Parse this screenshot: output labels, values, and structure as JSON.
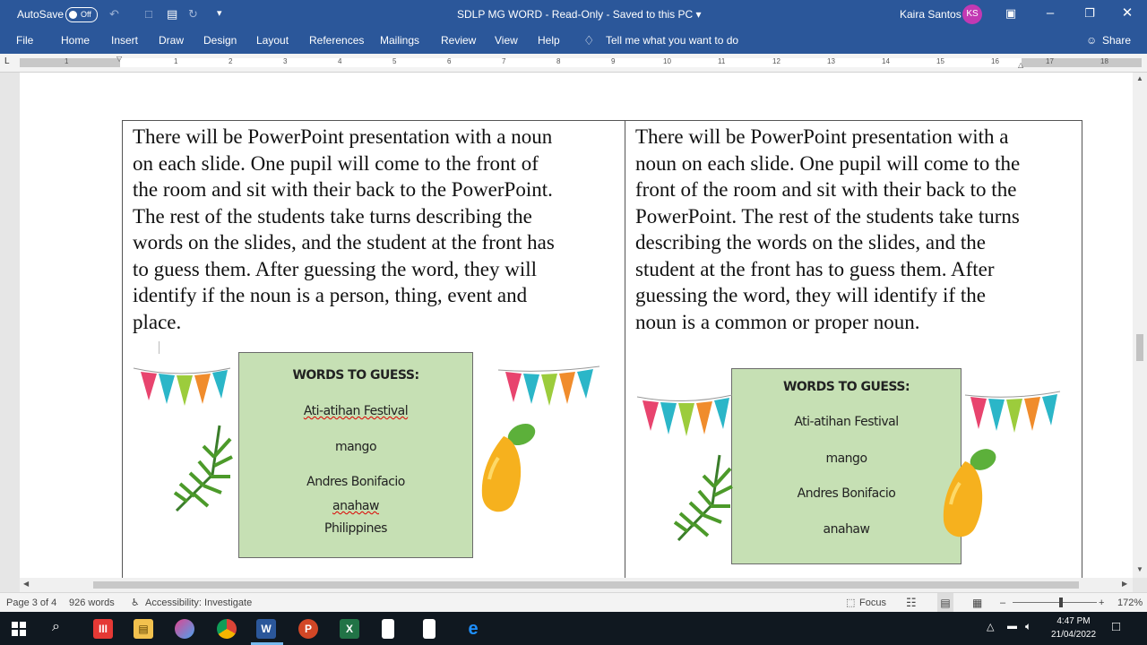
{
  "titlebar": {
    "autosave_label": "AutoSave",
    "autosave_state": "Off",
    "doc_title": "SDLP MG WORD  -  Read-Only  -  Saved to this PC  ▾",
    "user_name": "Kaira Santos",
    "user_initials": "KS"
  },
  "menu": {
    "file": "File",
    "home": "Home",
    "insert": "Insert",
    "draw": "Draw",
    "design": "Design",
    "layout": "Layout",
    "references": "References",
    "mailings": "Mailings",
    "review": "Review",
    "view": "View",
    "help": "Help",
    "tell_me": "Tell me what you want to do",
    "share": "Share"
  },
  "ruler": {
    "numbers": [
      "1",
      "1",
      "2",
      "3",
      "4",
      "5",
      "6",
      "7",
      "8",
      "9",
      "10",
      "11",
      "12",
      "13",
      "14",
      "15",
      "16",
      "17",
      "18"
    ]
  },
  "document": {
    "left_paragraph": [
      "There will be PowerPoint presentation with a noun",
      "on each slide. One pupil will come to the front of",
      "the room and sit with their back to the PowerPoint.",
      "The rest of the students take turns describing the",
      "words on the slides, and the student at the front has",
      "to guess them. After guessing the word, they will",
      "identify if the noun is a person, thing, event and",
      "place."
    ],
    "right_paragraph": [
      "There will be PowerPoint presentation with a",
      "noun on each slide. One pupil will come to the",
      "front of the room and sit with their back to the",
      "PowerPoint. The rest of the students take turns",
      "describing the words on the slides, and the",
      "student at the front has to guess them. After",
      "guessing the word, they will identify if the",
      "noun is a common or proper noun."
    ],
    "left_card": {
      "heading": "WORDS TO GUESS:",
      "word1": "Ati-atihan Festival",
      "word2": "mango",
      "word3": "Andres Bonifacio",
      "word4": "anahaw",
      "word5": "Philippines"
    },
    "right_card": {
      "heading": "WORDS TO GUESS:",
      "word1": "Ati-atihan Festival",
      "word2": "mango",
      "word3": "Andres Bonifacio",
      "word4": "anahaw"
    }
  },
  "status": {
    "page": "Page 3 of 4",
    "words": "926 words",
    "accessibility": "Accessibility: Investigate",
    "focus": "Focus",
    "zoom": "172%"
  },
  "taskbar": {
    "time": "4:47 PM",
    "date": "21/04/2022"
  },
  "colors": {
    "word_blue": "#2b579a",
    "card_green": "#c6e0b4",
    "flag_colors": [
      "#e8446e",
      "#2bb6c8",
      "#9ccc3c",
      "#f08c2c"
    ]
  }
}
